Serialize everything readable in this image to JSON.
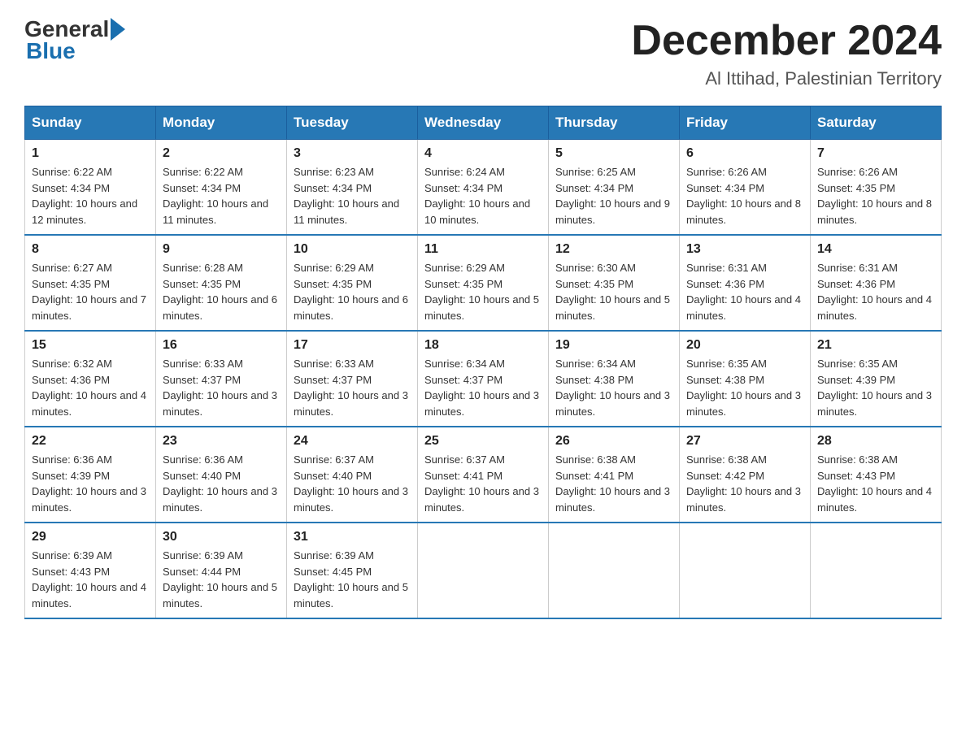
{
  "logo": {
    "general": "General",
    "blue": "Blue"
  },
  "title": {
    "month_year": "December 2024",
    "location": "Al Ittihad, Palestinian Territory"
  },
  "weekdays": [
    "Sunday",
    "Monday",
    "Tuesday",
    "Wednesday",
    "Thursday",
    "Friday",
    "Saturday"
  ],
  "weeks": [
    [
      {
        "day": "1",
        "sunrise": "6:22 AM",
        "sunset": "4:34 PM",
        "daylight": "10 hours and 12 minutes."
      },
      {
        "day": "2",
        "sunrise": "6:22 AM",
        "sunset": "4:34 PM",
        "daylight": "10 hours and 11 minutes."
      },
      {
        "day": "3",
        "sunrise": "6:23 AM",
        "sunset": "4:34 PM",
        "daylight": "10 hours and 11 minutes."
      },
      {
        "day": "4",
        "sunrise": "6:24 AM",
        "sunset": "4:34 PM",
        "daylight": "10 hours and 10 minutes."
      },
      {
        "day": "5",
        "sunrise": "6:25 AM",
        "sunset": "4:34 PM",
        "daylight": "10 hours and 9 minutes."
      },
      {
        "day": "6",
        "sunrise": "6:26 AM",
        "sunset": "4:34 PM",
        "daylight": "10 hours and 8 minutes."
      },
      {
        "day": "7",
        "sunrise": "6:26 AM",
        "sunset": "4:35 PM",
        "daylight": "10 hours and 8 minutes."
      }
    ],
    [
      {
        "day": "8",
        "sunrise": "6:27 AM",
        "sunset": "4:35 PM",
        "daylight": "10 hours and 7 minutes."
      },
      {
        "day": "9",
        "sunrise": "6:28 AM",
        "sunset": "4:35 PM",
        "daylight": "10 hours and 6 minutes."
      },
      {
        "day": "10",
        "sunrise": "6:29 AM",
        "sunset": "4:35 PM",
        "daylight": "10 hours and 6 minutes."
      },
      {
        "day": "11",
        "sunrise": "6:29 AM",
        "sunset": "4:35 PM",
        "daylight": "10 hours and 5 minutes."
      },
      {
        "day": "12",
        "sunrise": "6:30 AM",
        "sunset": "4:35 PM",
        "daylight": "10 hours and 5 minutes."
      },
      {
        "day": "13",
        "sunrise": "6:31 AM",
        "sunset": "4:36 PM",
        "daylight": "10 hours and 4 minutes."
      },
      {
        "day": "14",
        "sunrise": "6:31 AM",
        "sunset": "4:36 PM",
        "daylight": "10 hours and 4 minutes."
      }
    ],
    [
      {
        "day": "15",
        "sunrise": "6:32 AM",
        "sunset": "4:36 PM",
        "daylight": "10 hours and 4 minutes."
      },
      {
        "day": "16",
        "sunrise": "6:33 AM",
        "sunset": "4:37 PM",
        "daylight": "10 hours and 3 minutes."
      },
      {
        "day": "17",
        "sunrise": "6:33 AM",
        "sunset": "4:37 PM",
        "daylight": "10 hours and 3 minutes."
      },
      {
        "day": "18",
        "sunrise": "6:34 AM",
        "sunset": "4:37 PM",
        "daylight": "10 hours and 3 minutes."
      },
      {
        "day": "19",
        "sunrise": "6:34 AM",
        "sunset": "4:38 PM",
        "daylight": "10 hours and 3 minutes."
      },
      {
        "day": "20",
        "sunrise": "6:35 AM",
        "sunset": "4:38 PM",
        "daylight": "10 hours and 3 minutes."
      },
      {
        "day": "21",
        "sunrise": "6:35 AM",
        "sunset": "4:39 PM",
        "daylight": "10 hours and 3 minutes."
      }
    ],
    [
      {
        "day": "22",
        "sunrise": "6:36 AM",
        "sunset": "4:39 PM",
        "daylight": "10 hours and 3 minutes."
      },
      {
        "day": "23",
        "sunrise": "6:36 AM",
        "sunset": "4:40 PM",
        "daylight": "10 hours and 3 minutes."
      },
      {
        "day": "24",
        "sunrise": "6:37 AM",
        "sunset": "4:40 PM",
        "daylight": "10 hours and 3 minutes."
      },
      {
        "day": "25",
        "sunrise": "6:37 AM",
        "sunset": "4:41 PM",
        "daylight": "10 hours and 3 minutes."
      },
      {
        "day": "26",
        "sunrise": "6:38 AM",
        "sunset": "4:41 PM",
        "daylight": "10 hours and 3 minutes."
      },
      {
        "day": "27",
        "sunrise": "6:38 AM",
        "sunset": "4:42 PM",
        "daylight": "10 hours and 3 minutes."
      },
      {
        "day": "28",
        "sunrise": "6:38 AM",
        "sunset": "4:43 PM",
        "daylight": "10 hours and 4 minutes."
      }
    ],
    [
      {
        "day": "29",
        "sunrise": "6:39 AM",
        "sunset": "4:43 PM",
        "daylight": "10 hours and 4 minutes."
      },
      {
        "day": "30",
        "sunrise": "6:39 AM",
        "sunset": "4:44 PM",
        "daylight": "10 hours and 5 minutes."
      },
      {
        "day": "31",
        "sunrise": "6:39 AM",
        "sunset": "4:45 PM",
        "daylight": "10 hours and 5 minutes."
      },
      null,
      null,
      null,
      null
    ]
  ],
  "labels": {
    "sunrise": "Sunrise:",
    "sunset": "Sunset:",
    "daylight": "Daylight:"
  }
}
